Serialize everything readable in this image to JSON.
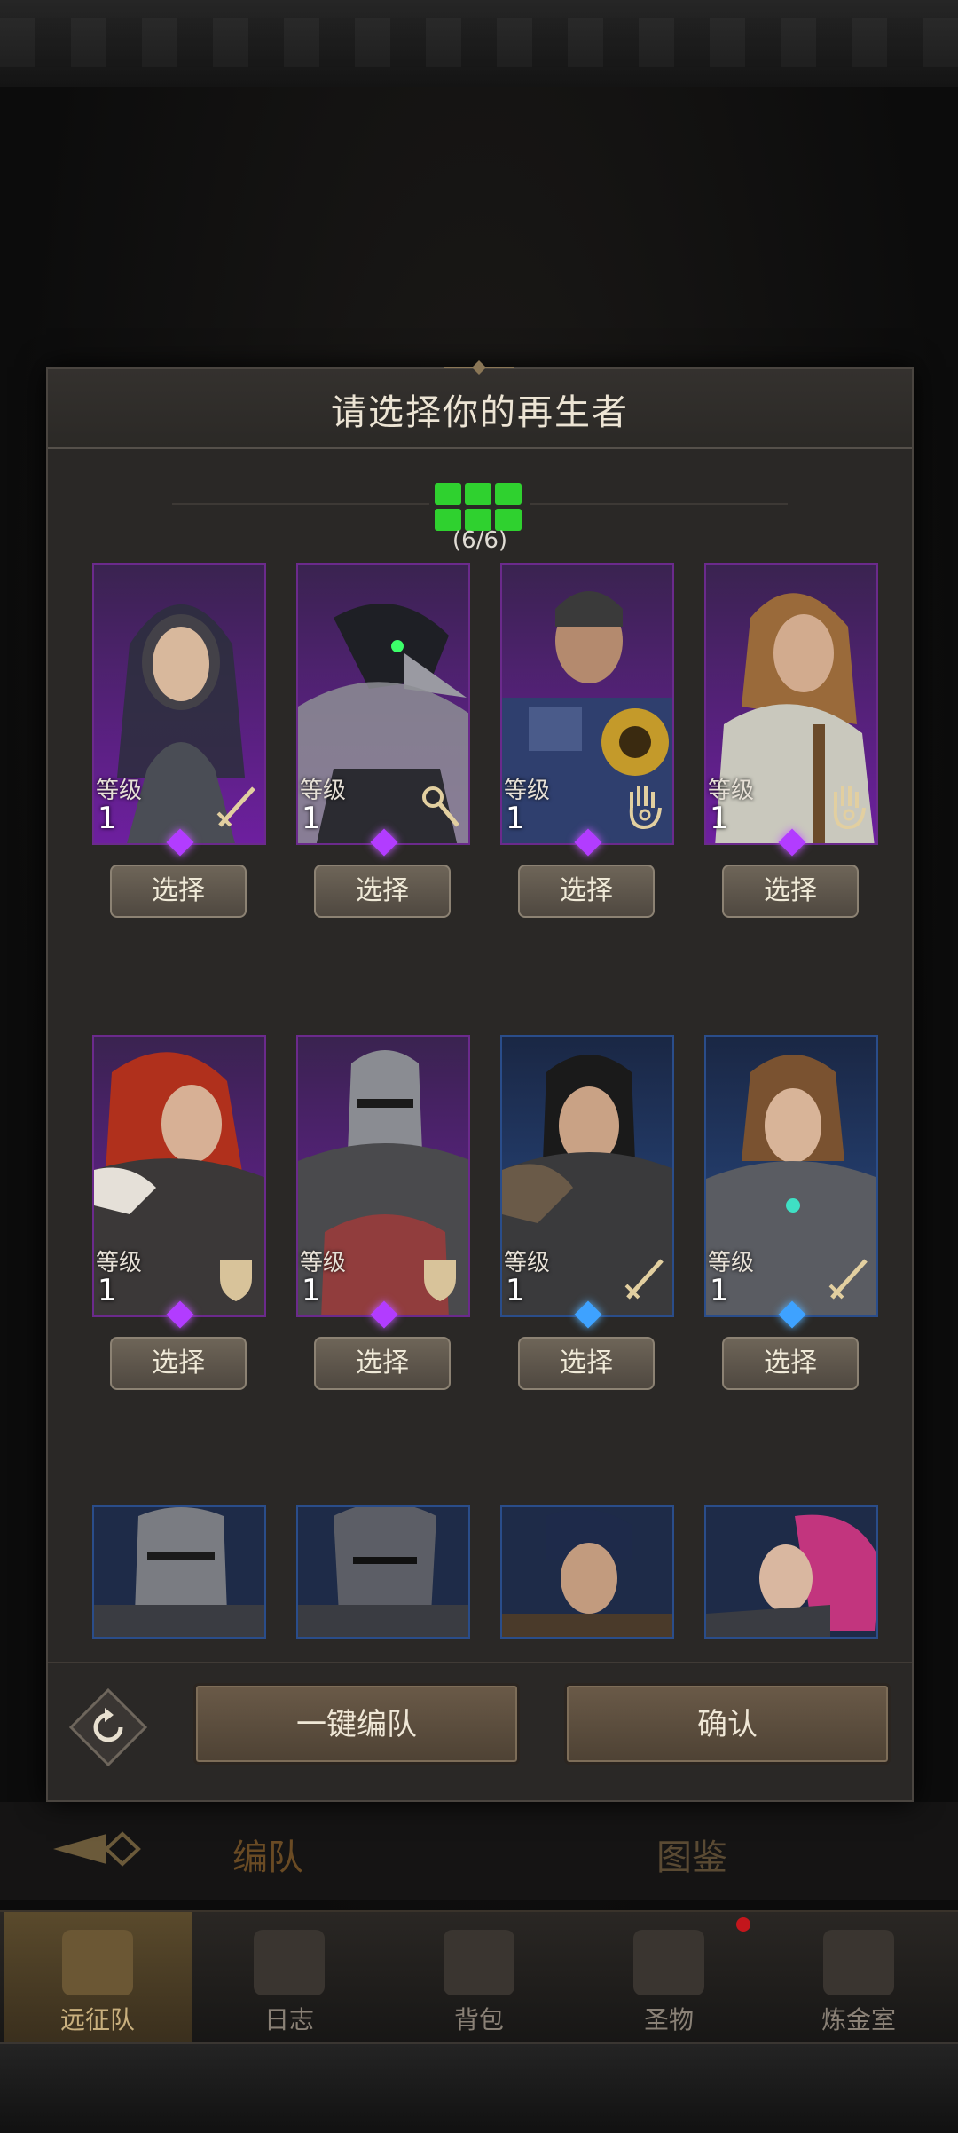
{
  "modal": {
    "title": "请选择你的再生者",
    "team_count": "(6/6)",
    "level_label": "等级",
    "select_label": "选择",
    "auto_team_label": "一键编队",
    "confirm_label": "确认"
  },
  "heroes": [
    {
      "level": "1",
      "rarity": "purple",
      "class_icon": "sword-icon"
    },
    {
      "level": "1",
      "rarity": "purple",
      "class_icon": "staff-icon"
    },
    {
      "level": "1",
      "rarity": "purple",
      "class_icon": "hand-icon"
    },
    {
      "level": "1",
      "rarity": "purple",
      "class_icon": "hand-icon"
    },
    {
      "level": "1",
      "rarity": "purple",
      "class_icon": "shield-icon"
    },
    {
      "level": "1",
      "rarity": "purple",
      "class_icon": "shield-icon"
    },
    {
      "level": "1",
      "rarity": "blue",
      "class_icon": "sword-icon"
    },
    {
      "level": "1",
      "rarity": "blue",
      "class_icon": "sword-icon"
    },
    {
      "rarity": "blue"
    },
    {
      "rarity": "blue"
    },
    {
      "rarity": "blue"
    },
    {
      "rarity": "blue"
    }
  ],
  "tabs": {
    "team": "编队",
    "codex": "图鉴"
  },
  "nav": [
    "远征队",
    "日志",
    "背包",
    "圣物",
    "炼金室"
  ],
  "colors": {
    "purple": "#6b2a8c",
    "blue": "#2a4d8a",
    "slot_green": "#2fd12f",
    "notification": "#c3161c"
  }
}
